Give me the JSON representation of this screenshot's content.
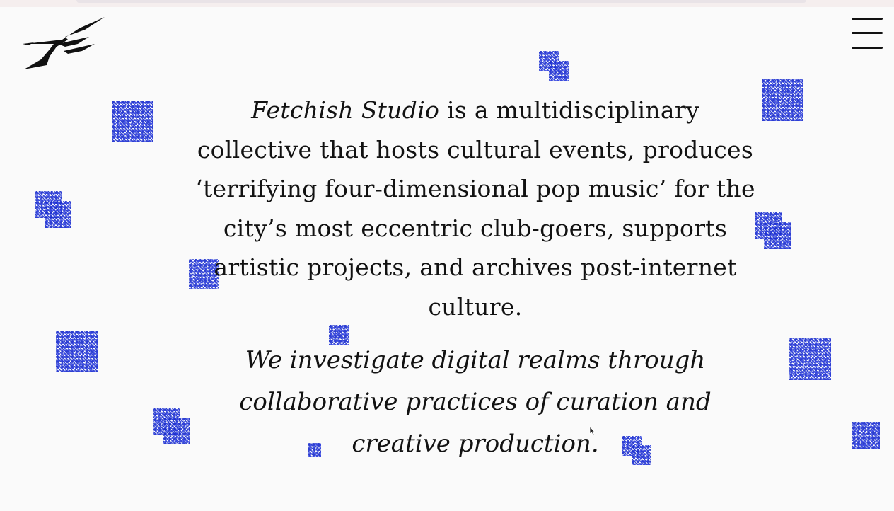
{
  "brand": {
    "logo_icon": "fetchish-logo-icon"
  },
  "nav": {
    "menu_icon": "hamburger-menu-icon"
  },
  "intro": {
    "studio_name": "Fetchish Studio",
    "description": " is a multidisciplinary collective that hosts cultural events, produces ‘terrifying four-dimensional pop music’ for the city’s most eccentric club-goers, supports artistic projects, and archives post-internet culture."
  },
  "mission": {
    "text": "We investigate digital realms through collaborative practices of curation and creative production."
  },
  "decor": {
    "tile_color": "#1c2fcf",
    "background_color": "#fafafa",
    "text_color": "#121212"
  }
}
